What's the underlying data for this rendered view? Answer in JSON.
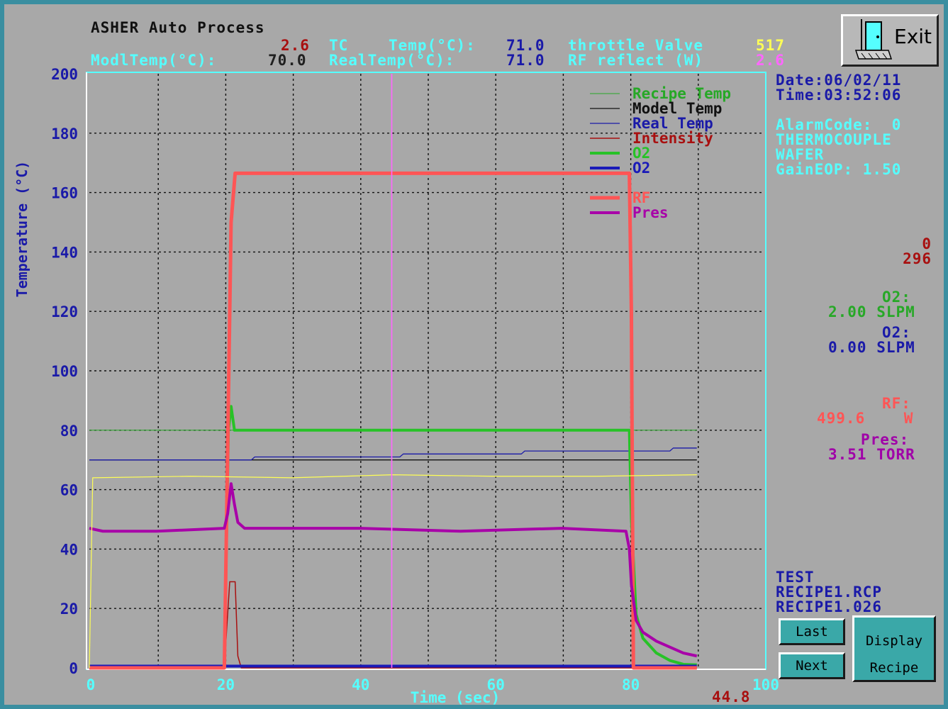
{
  "header": {
    "title": "ASHER Auto Process",
    "row1": {
      "tc_value": "2.6",
      "tc_label": "TC",
      "temp_label": "Temp(°C):",
      "temp_value": "71.0",
      "throttle_label": "throttle Valve",
      "throttle_value": "517"
    },
    "row2": {
      "modl_label": "ModlTemp(°C):",
      "modl_value": "70.0",
      "real_label": "RealTemp(°C):",
      "real_value": "71.0",
      "rf_reflect_label": "RF reflect (W)",
      "rf_reflect_value": "2.6"
    }
  },
  "exit_button": {
    "label": "Exit"
  },
  "side_panel": {
    "date": "Date:06/02/11",
    "time": "Time:03:52:06",
    "alarm": "AlarmCode:  0",
    "thermocouple": "THERMOCOUPLE",
    "wafer": "WAFER",
    "gain": "GainEOP: 1.50",
    "intensity_value": "0",
    "intensity_value2": "296",
    "o2_green_label": "O2:",
    "o2_green_value": "2.00 SLPM",
    "o2_blue_label": "O2:",
    "o2_blue_value": "0.00 SLPM",
    "rf_label": "RF:",
    "rf_value": "499.6    W",
    "pres_label": "Pres:",
    "pres_value": "3.51 TORR",
    "test": "TEST",
    "recipe_file": "RECIPE1.RCP",
    "recipe_log": "RECIPE1.026"
  },
  "buttons": {
    "last": "Last",
    "next": "Next",
    "display": "Display",
    "recipe": "Recipe"
  },
  "cursor_readout": "44.8",
  "colors": {
    "recipe_temp": "#27a827",
    "model_temp": "#111111",
    "real_temp": "#1a1aa8",
    "intensity": "#a81010",
    "o2_green": "#27c227",
    "o2_blue": "#1a1ab8",
    "rf": "#ff5555",
    "pres": "#a800a8",
    "throttle": "#ffff55",
    "cursor": "#ff66ff"
  },
  "chart_data": {
    "type": "line",
    "xlabel": "Time (sec)",
    "ylabel": "Temperature (°C)",
    "xlim": [
      0,
      100
    ],
    "ylim": [
      0,
      200
    ],
    "xticks": [
      0,
      20,
      40,
      60,
      80,
      100
    ],
    "yticks": [
      0,
      20,
      40,
      60,
      80,
      100,
      120,
      140,
      160,
      180,
      200
    ],
    "grid": true,
    "legend_position": "top-right",
    "cursor_x": 44.8,
    "series": [
      {
        "name": "Recipe Temp",
        "color": "#27a827",
        "width": 1,
        "x": [
          0,
          90
        ],
        "y": [
          80,
          80
        ]
      },
      {
        "name": "Model Temp",
        "color": "#111111",
        "width": 1.3,
        "x": [
          0,
          90
        ],
        "y": [
          70,
          70
        ]
      },
      {
        "name": "Real Temp",
        "color": "#1a1aa8",
        "width": 1.3,
        "x": [
          0,
          24,
          24.5,
          46,
          46.5,
          64,
          64.5,
          86,
          86.5,
          90
        ],
        "y": [
          70,
          70,
          71,
          71,
          72,
          72,
          73,
          73,
          74,
          74
        ]
      },
      {
        "name": "Intensity",
        "color": "#a81010",
        "width": 1.5,
        "x": [
          0,
          20,
          20.4,
          20.8,
          21.2,
          21.6,
          22.0,
          22.5,
          90
        ],
        "y": [
          0,
          0,
          15,
          29,
          29,
          29,
          4,
          0,
          0
        ]
      },
      {
        "name": "O2",
        "color": "#27c227",
        "width": 4,
        "x": [
          0,
          20,
          20.6,
          21,
          21.5,
          22,
          79.6,
          80,
          80.3,
          81,
          82,
          84,
          86,
          88,
          90
        ],
        "y": [
          0,
          0,
          80,
          88,
          80,
          80,
          80,
          80,
          50,
          18,
          10,
          5,
          2.5,
          1.2,
          1
        ]
      },
      {
        "name": "O2",
        "color": "#1a1ab8",
        "width": 4,
        "x": [
          0,
          90
        ],
        "y": [
          0.6,
          0.6
        ]
      },
      {
        "name": "RF",
        "color": "#ff5555",
        "width": 5,
        "x": [
          0,
          20,
          21,
          21.6,
          80,
          80.3,
          80.6,
          90
        ],
        "y": [
          0,
          0,
          150,
          166.5,
          166.5,
          120,
          0,
          0
        ]
      },
      {
        "name": "Pres",
        "color": "#a800a8",
        "width": 4,
        "x": [
          0,
          2,
          10,
          20,
          20.5,
          21,
          21.5,
          22,
          23,
          40,
          55,
          70,
          79.5,
          80,
          80.3,
          81,
          82,
          84,
          86,
          88,
          90
        ],
        "y": [
          47,
          46,
          46,
          47,
          52,
          62,
          55,
          49,
          47,
          47,
          46,
          47,
          46,
          40,
          28,
          16,
          12,
          9,
          7,
          5,
          4
        ]
      },
      {
        "color": "#ffff55",
        "width": 1.2,
        "x": [
          0,
          0.5,
          15,
          30,
          45,
          60,
          75,
          90
        ],
        "y": [
          0,
          64,
          64.5,
          64,
          65,
          64.5,
          64.5,
          65
        ]
      }
    ]
  }
}
